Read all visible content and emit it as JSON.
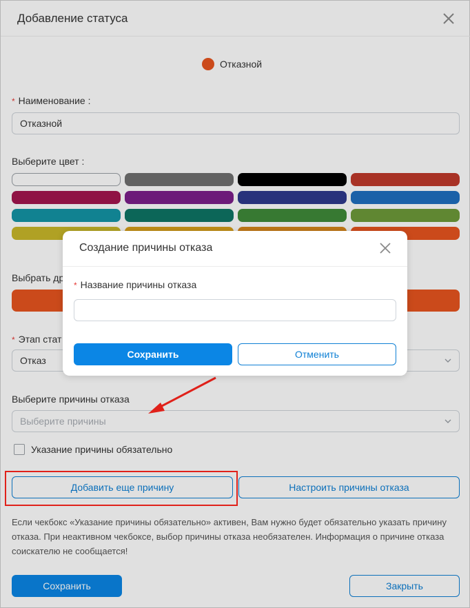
{
  "dialog": {
    "title": "Добавление статуса",
    "preview_status_name": "Отказной",
    "preview_color": "#e8551f",
    "name_label": "Наименование :",
    "name_value": "Отказной",
    "color_label": "Выберите цвет :",
    "colors": [
      "#ffffff",
      "#707070",
      "#000000",
      "#c0392b",
      "#a3154e",
      "#7b1e8a",
      "#2e3a8c",
      "#1f6fc0",
      "#1494a6",
      "#0e7565",
      "#3f8a3a",
      "#6e9a3a",
      "#c9b82a",
      "#d9a11c",
      "#d8871b",
      "#e8551f"
    ],
    "other_color_label": "Выбрать др",
    "stage_label": "Этап стат",
    "stage_value": "Отказ",
    "reasons_label": "Выберите причины отказа",
    "reasons_placeholder": "Выберите причины",
    "required_checkbox_label": "Указание причины обязательно",
    "add_reason_button": "Добавить еще причину",
    "configure_reasons_button": "Настроить причины отказа",
    "hint": "Если чекбокс «Указание причины обязательно» активен, Вам нужно будет обязательно указать причину отказа. При неактивном чекбоксе, выбор причины отказа необязателен. Информация о причине отказа соискателю не сообщается!",
    "save_button": "Сохранить",
    "close_button": "Закрыть"
  },
  "modal": {
    "title": "Создание причины отказа",
    "field_label": "Название причины отказа",
    "field_value": "",
    "save_button": "Сохранить",
    "cancel_button": "Отменить"
  }
}
